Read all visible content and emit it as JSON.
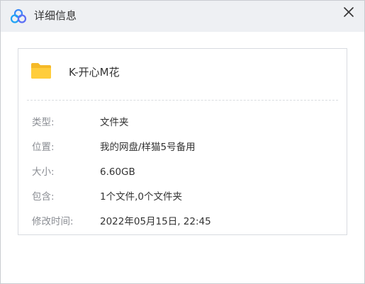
{
  "window": {
    "title": "详细信息",
    "title_icon": "baidu-netdisk-logo-icon",
    "close_icon": "close-icon"
  },
  "file": {
    "icon": "folder-icon",
    "name": "K-开心M花"
  },
  "details": {
    "type": {
      "label": "类型:",
      "value": "文件夹"
    },
    "location": {
      "label": "位置:",
      "value": "我的网盘/样猫5号备用"
    },
    "size": {
      "label": "大小:",
      "value": "6.60GB"
    },
    "contains": {
      "label": "包含:",
      "value": "1个文件,0个文件夹"
    },
    "modified": {
      "label": "修改时间:",
      "value": "2022年05月15日, 22:45"
    }
  },
  "colors": {
    "titlebar_bg": "#eef0f3",
    "folder_yellow": "#ffc933",
    "logo_blue": "#3b8af7",
    "label_gray": "#8a8d93",
    "value_text": "#333333"
  }
}
